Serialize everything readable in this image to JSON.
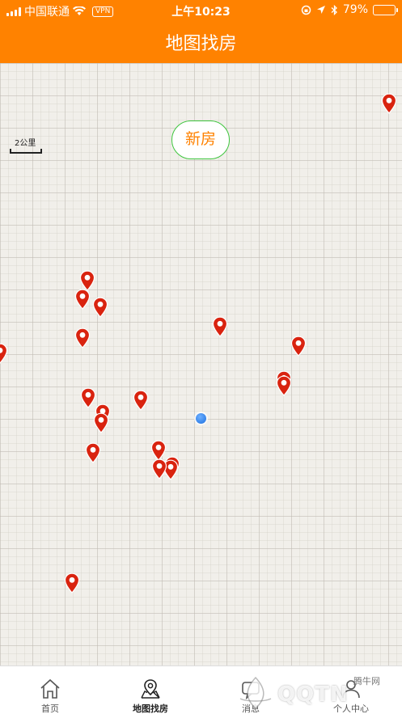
{
  "status_bar": {
    "carrier": "中国联通",
    "vpn": "VPN",
    "time": "上午10:23",
    "battery": "79%",
    "battery_level": 0.79
  },
  "nav": {
    "title": "地图找房"
  },
  "map": {
    "scale_label": "2公里",
    "filter_chip": "新房",
    "pin_color": "#d9230f",
    "pins": [
      {
        "id": 1
      },
      {
        "id": 2
      },
      {
        "id": 3
      },
      {
        "id": 4
      },
      {
        "id": 5
      },
      {
        "id": 6
      },
      {
        "id": 7
      },
      {
        "id": 8
      },
      {
        "id": 9
      },
      {
        "id": 10
      },
      {
        "id": 11
      },
      {
        "id": 12
      },
      {
        "id": 13
      },
      {
        "id": 14
      },
      {
        "id": 15
      },
      {
        "id": 16
      },
      {
        "id": 17
      },
      {
        "id": 18
      },
      {
        "id": 19
      },
      {
        "id": 20
      },
      {
        "id": 21
      }
    ]
  },
  "tabs": [
    {
      "label": "首页",
      "icon": "home-icon",
      "active": false
    },
    {
      "label": "地图找房",
      "icon": "map-pin-icon",
      "active": true
    },
    {
      "label": "消息",
      "icon": "message-icon",
      "active": false
    },
    {
      "label": "个人中心",
      "icon": "person-icon",
      "active": false
    }
  ],
  "watermark": {
    "text": "QQTN",
    "small": "腾牛网"
  },
  "colors": {
    "primary": "#ff8200",
    "chip_border": "#3ec53e",
    "pin": "#d9230f",
    "location": "#1a6fe0"
  }
}
